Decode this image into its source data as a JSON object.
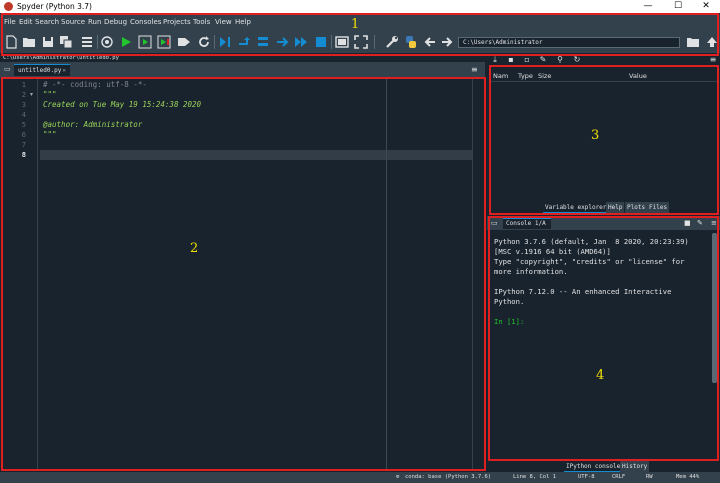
{
  "window": {
    "title": "Spyder (Python 3.7)",
    "minimize": "—",
    "maximize": "☐",
    "close": "✕"
  },
  "menu": [
    "File",
    "Edit",
    "Search",
    "Source",
    "Run",
    "Debug",
    "Consoles",
    "Projects",
    "Tools",
    "View",
    "Help"
  ],
  "toolbar": {
    "path": "C:\\Users\\Administrator",
    "icons": [
      "new-file-icon",
      "open-folder-icon",
      "save-icon",
      "save-all-icon",
      "file-list-icon",
      "at-icon",
      "run-icon",
      "run-cell-icon",
      "run-cell-advance-icon",
      "run-selection-icon",
      "rerun-icon",
      "debug-icon",
      "step-icon",
      "step-into-icon",
      "step-return-icon",
      "continue-icon",
      "stop-icon",
      "maximize-pane-icon",
      "fullscreen-icon",
      "wrench-icon",
      "python-path-icon",
      "back-arrow-icon",
      "forward-arrow-icon",
      "browse-folder-icon",
      "parent-dir-icon"
    ]
  },
  "annotations": {
    "a1": "1",
    "a2": "2",
    "a3": "3",
    "a4": "4"
  },
  "editor": {
    "path": "C:\\Users\\Administrator\\untitled0.py",
    "tab_label": "untitled0.py",
    "tab_close": "✕",
    "line_numbers": [
      "1",
      "2",
      "3",
      "4",
      "5",
      "6",
      "7",
      "8"
    ],
    "current_line": "8",
    "lines": [
      "# -*- coding: utf-8 -*-",
      "\"\"\"",
      "Created on Tue May 19 15:24:38 2020",
      "",
      "@author: Administrator",
      "\"\"\"",
      "",
      ""
    ]
  },
  "variable_explorer": {
    "columns": [
      "Nam",
      "Type",
      "Size",
      "Value"
    ],
    "tabs": [
      "Variable explorer",
      "Help",
      "Plots",
      "Files"
    ]
  },
  "console": {
    "tab_label": "Console 1/A",
    "lines": [
      "Python 3.7.6 (default, Jan  8 2020, 20:23:39)",
      "[MSC v.1916 64 bit (AMD64)]",
      "Type \"copyright\", \"credits\" or \"license\" for",
      "more information.",
      "",
      "IPython 7.12.0 -- An enhanced Interactive",
      "Python.",
      "",
      "In [1]:"
    ],
    "tabs": [
      "IPython console",
      "History"
    ]
  },
  "status": {
    "conda": "conda: base (Python 3.7.6)",
    "position": "Line 8, Col 1",
    "encoding": "UTF-8",
    "eol": "CRLF",
    "permissions": "RW",
    "memory": "Mem 44%"
  },
  "colors": {
    "accent": "#148cd2",
    "annotation_border": "#e02020",
    "annotation_number": "#f0e000",
    "background": "#19232d",
    "panel": "#32414b"
  }
}
